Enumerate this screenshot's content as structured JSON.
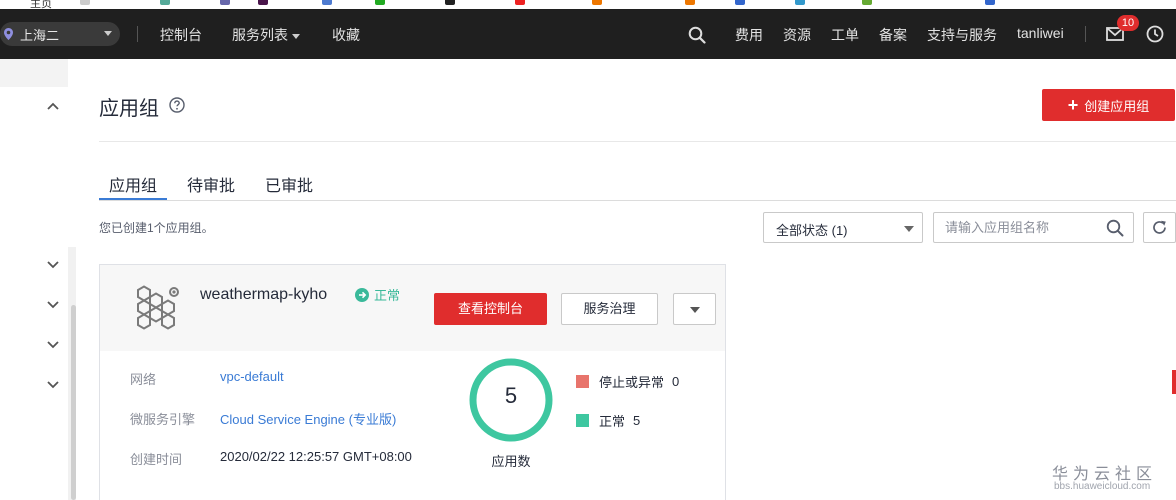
{
  "topnav": {
    "region": "上海二",
    "console": "控制台",
    "service_list": "服务列表",
    "favorites": "收藏",
    "billing": "费用",
    "resources": "资源",
    "tickets": "工单",
    "filing": "备案",
    "support": "支持与服务",
    "username": "tanliwei",
    "notification_count": "10"
  },
  "page": {
    "title": "应用组",
    "create_button": "创建应用组"
  },
  "tabs": [
    {
      "label": "应用组",
      "active": true
    },
    {
      "label": "待审批",
      "active": false
    },
    {
      "label": "已审批",
      "active": false
    }
  ],
  "toolbar": {
    "summary": "您已创建1个应用组。",
    "status_filter": "全部状态 (1)",
    "search_placeholder": "请输入应用组名称"
  },
  "card": {
    "name": "weathermap-kyho",
    "status": "正常",
    "console_button": "查看控制台",
    "governance_button": "服务治理",
    "fields": [
      {
        "label": "网络",
        "value": "vpc-default",
        "link": true
      },
      {
        "label": "微服务引擎",
        "value": "Cloud Service Engine (专业版)",
        "link": true
      },
      {
        "label": "创建时间",
        "value": "2020/02/22 12:25:57 GMT+08:00",
        "link": false
      }
    ],
    "app_count": "5",
    "app_count_label": "应用数",
    "legend": [
      {
        "label": "停止或异常",
        "count": "0",
        "color": "#e8746c"
      },
      {
        "label": "正常",
        "count": "5",
        "color": "#3ec7a0"
      }
    ]
  },
  "colors": {
    "accent_red": "#e02d2d",
    "ok_green": "#3ab99a",
    "link_blue": "#3a7bd5"
  },
  "watermark": {
    "title": "华为云社区",
    "url": "bbs.huaweicloud.com"
  }
}
